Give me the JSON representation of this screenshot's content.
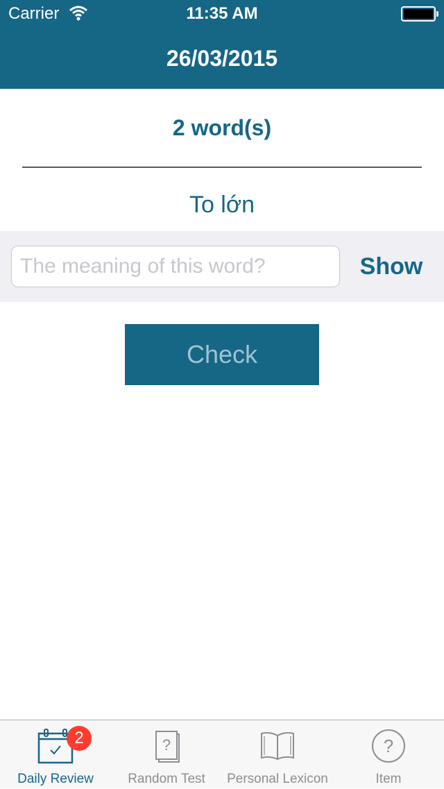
{
  "status_bar": {
    "carrier": "Carrier",
    "time": "11:35 AM"
  },
  "nav": {
    "title": "26/03/2015"
  },
  "review": {
    "count_label": "2 word(s)",
    "word": "To lớn",
    "answer_placeholder": "The meaning of this word?",
    "answer_value": "",
    "show_label": "Show",
    "check_label": "Check"
  },
  "tab_bar": {
    "tabs": [
      {
        "label": "Daily Review",
        "icon": "calendar-check-icon",
        "badge": "2",
        "active": true
      },
      {
        "label": "Random Test",
        "icon": "question-card-icon"
      },
      {
        "label": "Personal Lexicon",
        "icon": "open-book-icon"
      },
      {
        "label": "Item",
        "icon": "question-circle-icon"
      }
    ]
  },
  "colors": {
    "primary": "#166686",
    "check_text": "#9fc3d3",
    "badge": "#ff3b30",
    "tab_inactive": "#8e8e93"
  }
}
